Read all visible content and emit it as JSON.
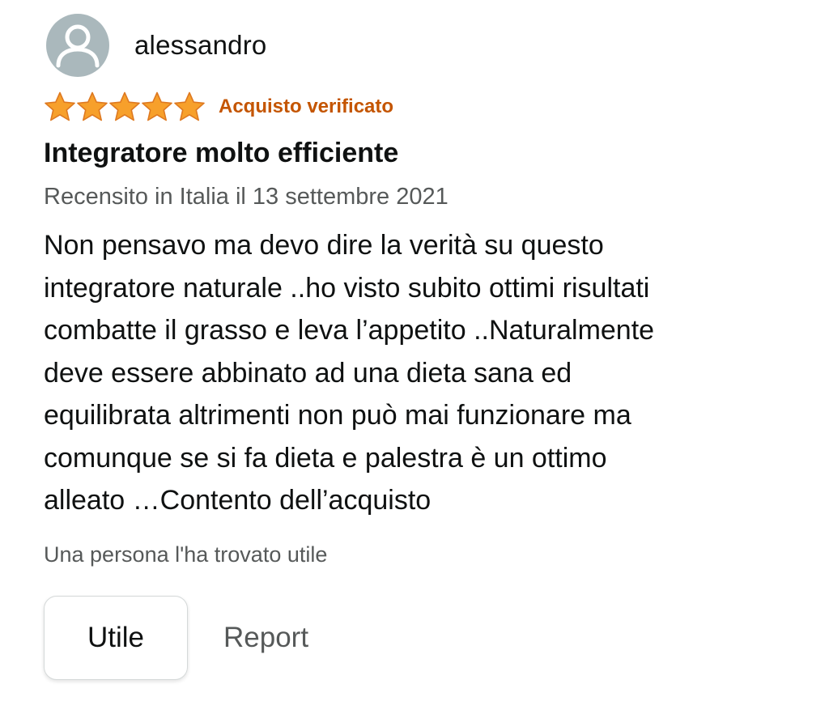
{
  "review": {
    "author": {
      "name": "alessandro",
      "avatar_icon": "user-silhouette-icon",
      "avatar_color": "#aab8bc"
    },
    "rating": {
      "stars": 5,
      "max": 5,
      "star_icon": "star-icon",
      "star_color": "#f7a02b"
    },
    "verified_label": "Acquisto verificato",
    "verified_color": "#c45500",
    "title": "Integratore molto efficiente",
    "date_text": "Recensito in Italia il 13 settembre 2021",
    "body_lines": [
      "Non pensavo ma devo dire la verità su questo",
      "integratore naturale ..ho visto subito ottimi risultati",
      "combatte il grasso e leva l’appetito ..Naturalmente",
      "deve essere abbinato ad una dieta sana ed",
      "equilibrata altrimenti non può mai funzionare ma",
      "comunque se si fa dieta e palestra è un ottimo",
      "alleato …Contento dell’acquisto"
    ],
    "helpful_text": "Una persona l'ha trovato utile",
    "actions": {
      "helpful_button_label": "Utile",
      "report_label": "Report"
    }
  }
}
